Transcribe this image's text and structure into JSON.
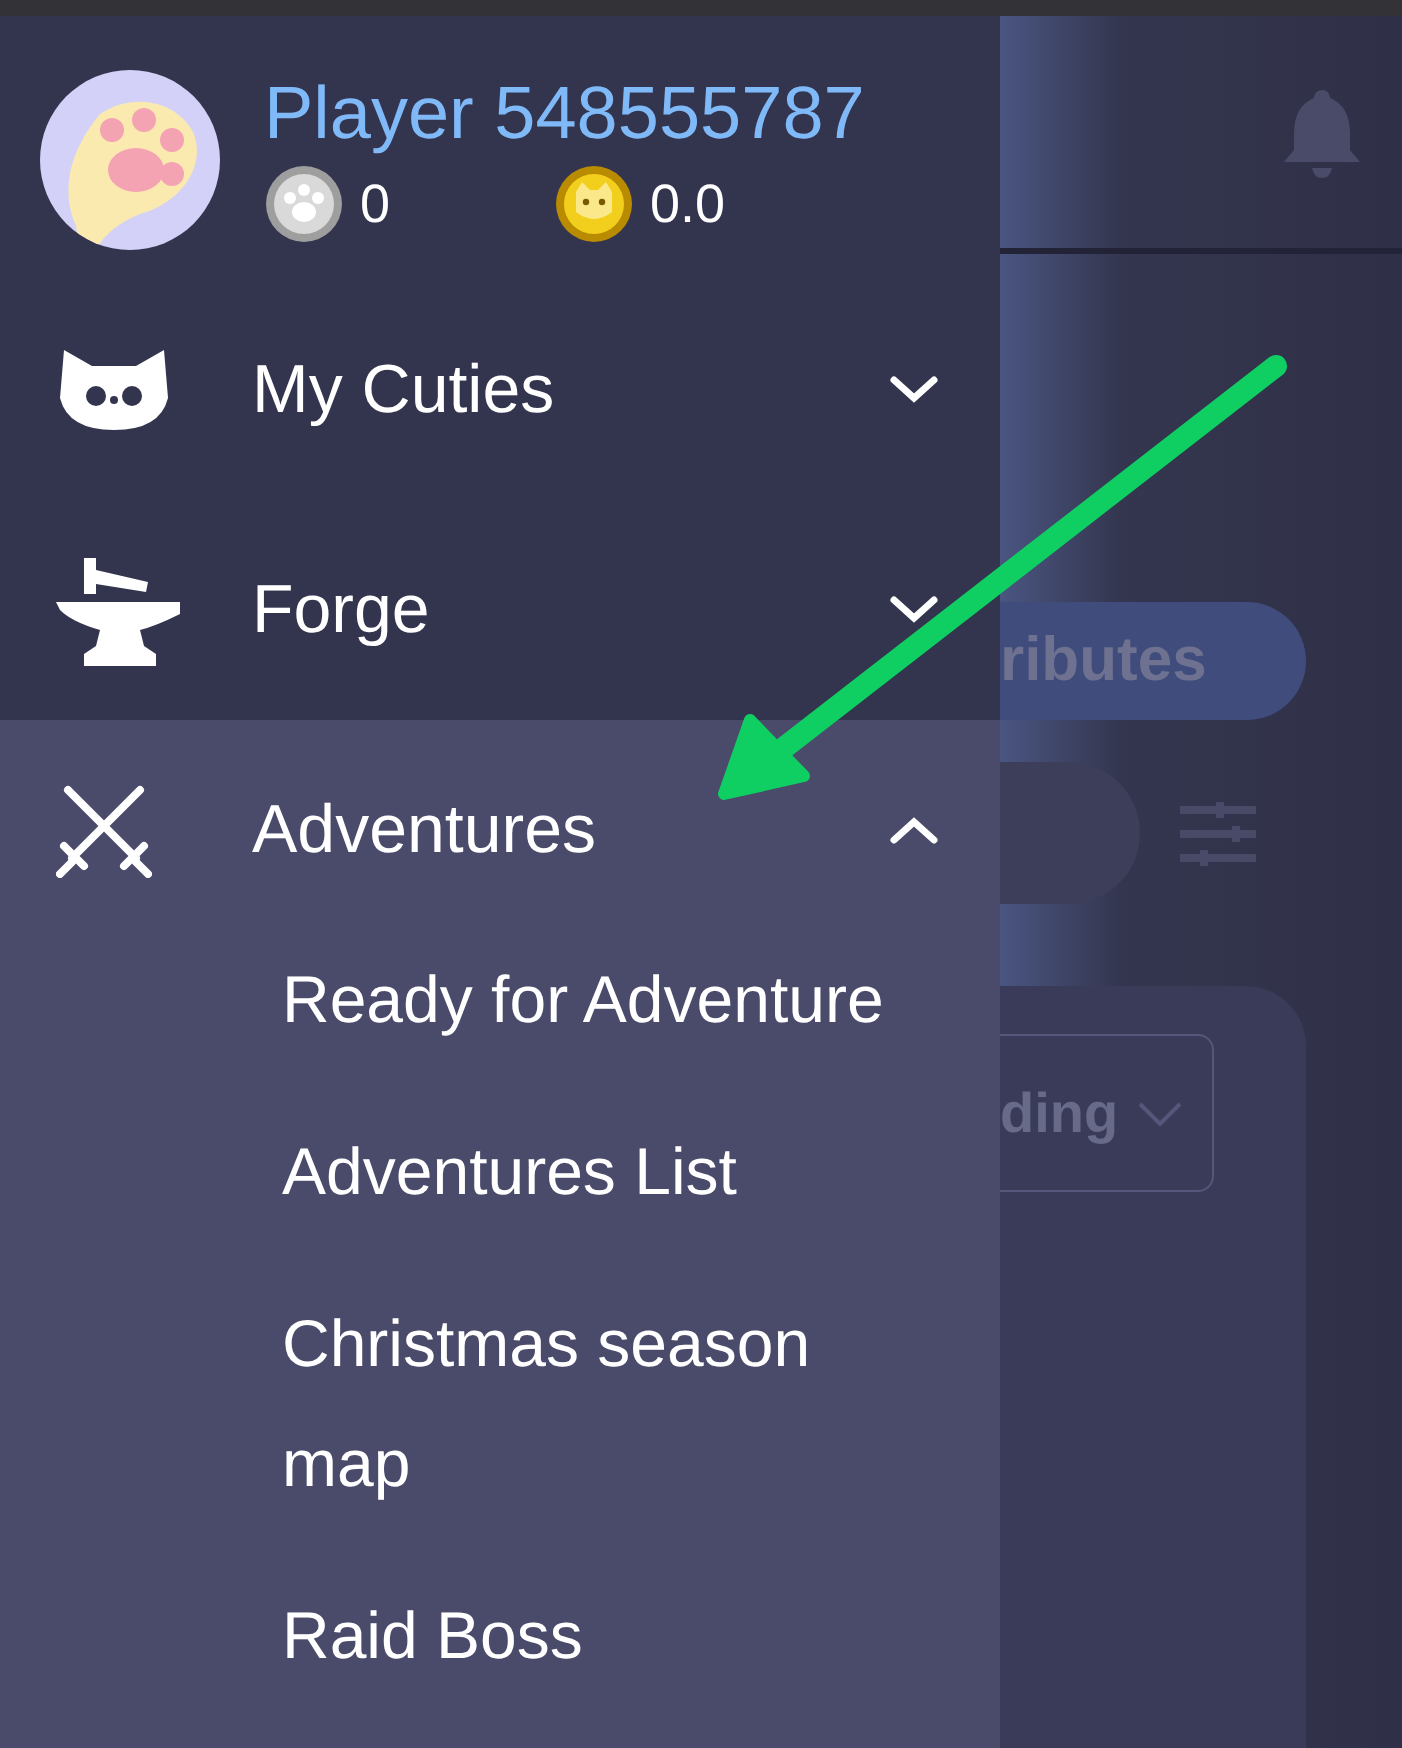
{
  "player": {
    "name": "Player 548555787",
    "currencies": [
      {
        "kind": "silver",
        "amount": "0"
      },
      {
        "kind": "gold",
        "amount": "0.0"
      }
    ]
  },
  "menu": [
    {
      "kind": "cuties",
      "label": "My Cuties",
      "expanded": false
    },
    {
      "kind": "forge",
      "label": "Forge",
      "expanded": false
    },
    {
      "kind": "adventures",
      "label": "Adventures",
      "expanded": true,
      "children": [
        {
          "label": "Ready for Adventure"
        },
        {
          "label": "Adventures List"
        },
        {
          "label": "Christmas season map"
        },
        {
          "label": "Raid Boss"
        }
      ]
    }
  ],
  "main": {
    "pill_button": {
      "label": "ributes"
    },
    "dropdown": {
      "value": "ding"
    }
  }
}
